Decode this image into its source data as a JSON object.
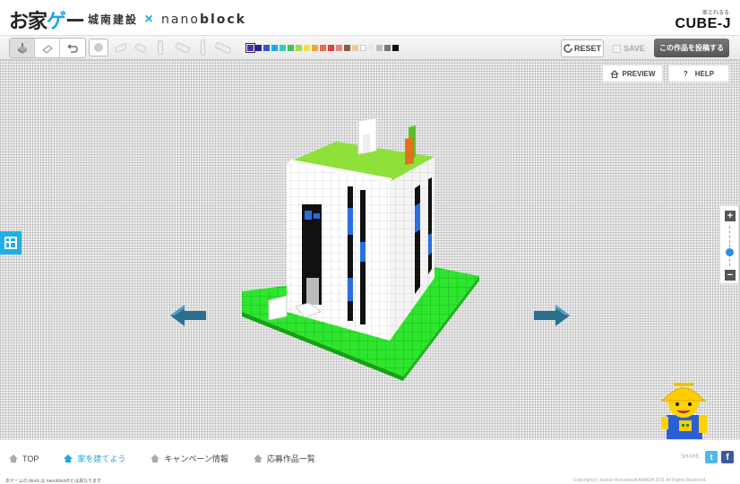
{
  "header": {
    "logo_main": "お家",
    "logo_accent": "ゲ",
    "logo_tail": "ー",
    "partner_jp": "城南建設",
    "partner_x": "×",
    "partner_nano": "nano",
    "partner_block": "block",
    "brand_sub": "家とれるる",
    "brand_main": "CUBE-J"
  },
  "toolbar": {
    "tools": [
      "place-tool",
      "erase-tool",
      "undo-tool"
    ],
    "palette": [
      "#5a2db8",
      "#2a2296",
      "#2a5ad8",
      "#25a6e8",
      "#2ad0c8",
      "#3fc75a",
      "#9ee03b",
      "#f3e43a",
      "#f2a82f",
      "#e86a4f",
      "#ea3b3b",
      "#d98a8a",
      "#8a5d3a",
      "#e8c9a0",
      "#ffffff",
      "#e8e8e8",
      "#bdbdbd",
      "#777777",
      "#111111"
    ],
    "selected_color": "#5a2db8",
    "reset_label": "RESET",
    "save_label": "SAVE",
    "post_label": "この作品を投稿する"
  },
  "canvas": {
    "preview_label": "PREVIEW",
    "help_label": "HELP",
    "help_icon": "?",
    "zoom_in": "+",
    "zoom_out": "−",
    "zoom_level": 0.35
  },
  "footer": {
    "nav": [
      "TOP",
      "家を建てよう",
      "キャンペーン情報",
      "応募作品一覧"
    ],
    "active_index": 1,
    "share_label": "SHARE",
    "twitter_icon": "t",
    "facebook_icon": "f",
    "footnote": "本ゲームの block は nanoblock®とは異なります",
    "copyright": "Copyright(c) Jounan-Kensetsu/KAWADA 2011 All Rights Reserved."
  }
}
